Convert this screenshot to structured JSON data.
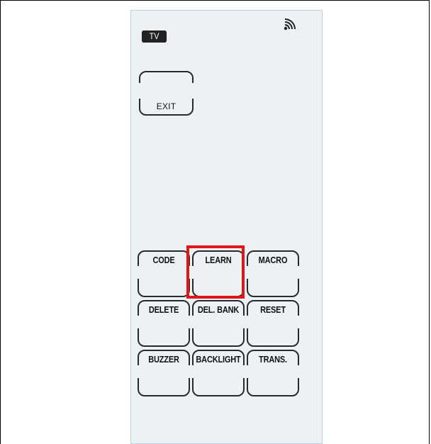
{
  "device": {
    "mode_badge": "TV",
    "signal_icon": "signal-wave-icon",
    "exit_label": "EXIT"
  },
  "buttons": [
    {
      "label": "CODE"
    },
    {
      "label": "LEARN",
      "highlighted": true
    },
    {
      "label": "MACRO"
    },
    {
      "label": "DELETE"
    },
    {
      "label": "DEL. BANK"
    },
    {
      "label": "RESET"
    },
    {
      "label": "BUZZER"
    },
    {
      "label": "BACKLIGHT"
    },
    {
      "label": "TRANS."
    }
  ],
  "colors": {
    "lcd_background": "#edf1f3",
    "highlight": "#e0161b",
    "badge": "#222222"
  }
}
